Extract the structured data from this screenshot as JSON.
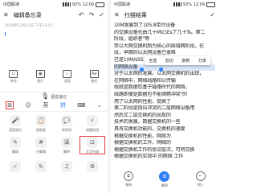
{
  "left": {
    "status": {
      "carrier": "中国联通",
      "right": "93% 12:09"
    },
    "nav": {
      "title": "编辑备忘录"
    },
    "date": "2019年12月11日 下午12:07",
    "toolbar": [
      {
        "name": "待办",
        "sym": "☐"
      },
      {
        "name": "图片",
        "sym": "▣"
      },
      {
        "name": "语音",
        "sym": "♪"
      },
      {
        "name": "格式",
        "sym": "Aa"
      }
    ],
    "voice_label": "语音速记",
    "kbrow": {
      "grid": "⊞",
      "smile": "☺",
      "eng": "英",
      "pin": "拼",
      "keyboard": "⌨",
      "hide": "⌄"
    },
    "grid_items": [
      {
        "label": "语音速记",
        "icon": "🎤"
      },
      {
        "label": "剪贴板",
        "icon": "📋"
      },
      {
        "label": "常用语",
        "icon": "💬"
      },
      {
        "label": "快捷短语",
        "icon": "⚡"
      },
      {
        "label": "编辑",
        "icon": "✎"
      },
      {
        "label": "计算器",
        "icon": "#"
      },
      {
        "label": "翻译",
        "icon": "译"
      },
      {
        "label": "文字扫描",
        "icon": "⊡"
      },
      {
        "label": "",
        "icon": "✓"
      },
      {
        "label": "",
        "icon": "↻"
      },
      {
        "label": "",
        "icon": "♫"
      },
      {
        "label": "",
        "icon": "⚙"
      }
    ]
  },
  "right": {
    "status": {
      "carrier": "中国联通",
      "right": "93% 12:09"
    },
    "nav": {
      "title": "扫描结果"
    },
    "lines": [
      "10M发展到了105.8单台设备",
      "的交换设备也由几十M\\C\\Es了几十Ts。第二",
      "阶段，组织者\"等",
      "势以大网交换机制为核心的局域网阶段，在",
      "段，早期的以太网设备已很难",
      "已是10M/sSS 与1000M",
      "的网络设备",
      "对于以太网的发展，以太网交换机的出现，",
      "在网络中，网络线路和以传输",
      "线就是数据包基于链路时代的网络，",
      "线路即便是数据包不能顺畅冲突\"的",
      "用了以太网的性能，提高了",
      "第二阶段是指向冲突的二层网络设备用",
      "然后又二层交换机的出现的",
      "技术的发展，数据交换机的一些",
      "具有交换机功能的，交换机的速度",
      "根据交换机的性能，网络为",
      "根据交换机的工作，网络的",
      "根据交换机工作的协议层次，可将交换",
      "根据交换机的实现中 的网络 工作"
    ],
    "popup": [
      "全选",
      "剪切",
      "复制",
      "分享"
    ],
    "bottom": [
      {
        "label": "复制",
        "icon": "⧉"
      },
      {
        "label": "翻译",
        "icon": "译"
      },
      {
        "label": "插入",
        "icon": "↵"
      }
    ]
  }
}
